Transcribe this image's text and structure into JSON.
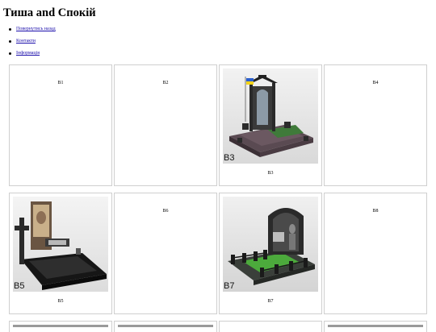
{
  "page": {
    "title": "Тиша and Спокій"
  },
  "nav": [
    {
      "label": "Повернутись назад"
    },
    {
      "label": "Контакти"
    },
    {
      "label": "Інформація"
    }
  ],
  "rows": [
    [
      {
        "label": "B1",
        "image": false
      },
      {
        "label": "B2",
        "image": false
      },
      {
        "label": "B3",
        "image": true,
        "image_tag": "B3",
        "image_kind": "monument-arch-flag"
      },
      {
        "label": "B4",
        "image": false
      }
    ],
    [
      {
        "label": "B5",
        "image": true,
        "image_tag": "B5",
        "image_kind": "monument-cross"
      },
      {
        "label": "B6",
        "image": false
      },
      {
        "label": "B7",
        "image": true,
        "image_tag": "B7",
        "image_kind": "monument-arch-fence"
      },
      {
        "label": "B8",
        "image": false
      }
    ]
  ]
}
